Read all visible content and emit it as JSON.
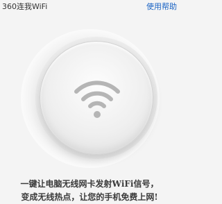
{
  "header": {
    "title": "360连我WiFi",
    "help_label": "使用帮助"
  },
  "description": {
    "line1": "一键让电脑无线网卡发射WiFi信号，",
    "line2": "变成无线热点，让您的手机免费上网!"
  },
  "icons": {
    "wifi": "wifi-icon"
  },
  "colors": {
    "link": "#1a63c4",
    "icon": "#b5b5b5",
    "text": "#3a3a3a",
    "background": "#f4f4f4"
  }
}
